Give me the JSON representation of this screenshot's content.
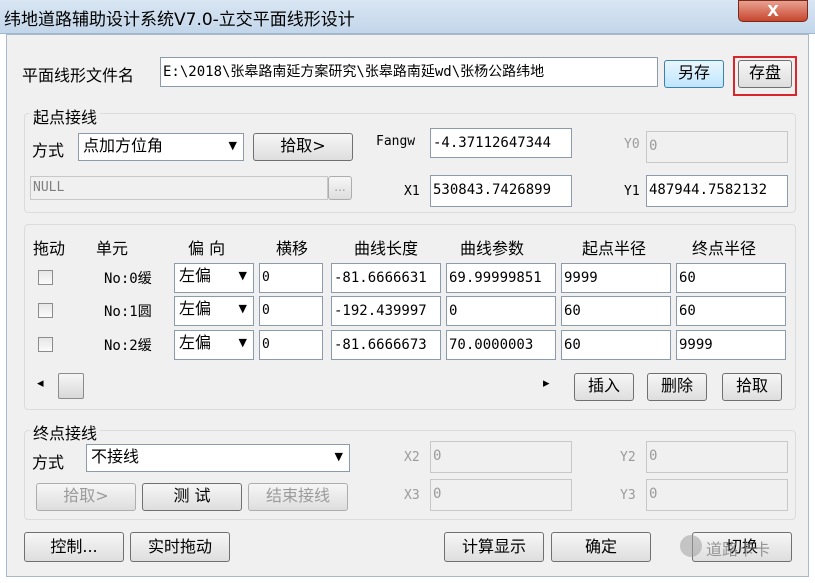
{
  "window": {
    "title": "纬地道路辅助设计系统V7.0-立交平面线形设计",
    "close": "X"
  },
  "file": {
    "label": "平面线形文件名",
    "value": "E:\\2018\\张皋路南延方案研究\\张皋路南延wd\\张杨公路纬地",
    "save_as": "另存",
    "save": "存盘"
  },
  "start": {
    "title": "起点接线",
    "mode_label": "方式",
    "mode_value": "点加方位角",
    "pick": "拾取>",
    "null_value": "NULL",
    "browse": "...",
    "fangw_label": "Fangw",
    "fangw_value": "-4.37112647344",
    "y0_label": "Y0",
    "y0_value": "0",
    "x1_label": "X1",
    "x1_value": "530843.7426899",
    "y1_label": "Y1",
    "y1_value": "487944.7582132"
  },
  "units": {
    "headers": [
      "拖动",
      "单元",
      "偏 向",
      "横移",
      "曲线长度",
      "曲线参数",
      "起点半径",
      "终点半径"
    ],
    "rows": [
      {
        "name": "No:0缓",
        "dir": "左偏",
        "shift": "0",
        "length": "-81.6666631",
        "param": "69.99999851",
        "r_start": "9999",
        "r_end": "60"
      },
      {
        "name": "No:1圆",
        "dir": "左偏",
        "shift": "0",
        "length": "-192.439997",
        "param": "0",
        "r_start": "60",
        "r_end": "60"
      },
      {
        "name": "No:2缓",
        "dir": "左偏",
        "shift": "0",
        "length": "-81.6666673",
        "param": "70.0000003",
        "r_start": "60",
        "r_end": "9999"
      }
    ],
    "insert": "插入",
    "delete": "删除",
    "pick": "拾取",
    "scroll_left": "◂",
    "scroll_right": "▸"
  },
  "end": {
    "title": "终点接线",
    "mode_label": "方式",
    "mode_value": "不接线",
    "pick": "拾取>",
    "test": "测 试",
    "finish": "结束接线",
    "x2_label": "X2",
    "x2_value": "0",
    "y2_label": "Y2",
    "y2_value": "0",
    "x3_label": "X3",
    "x3_value": "0",
    "y3_label": "Y3",
    "y3_value": "0"
  },
  "footer": {
    "control": "控制...",
    "realtime": "实时拖动",
    "calc": "计算显示",
    "ok": "确定",
    "switch": "切换",
    "watermark": "道路卡卡"
  },
  "colors": {
    "highlight_box": "#d8262b",
    "title_bar": "#c3d6ea"
  }
}
